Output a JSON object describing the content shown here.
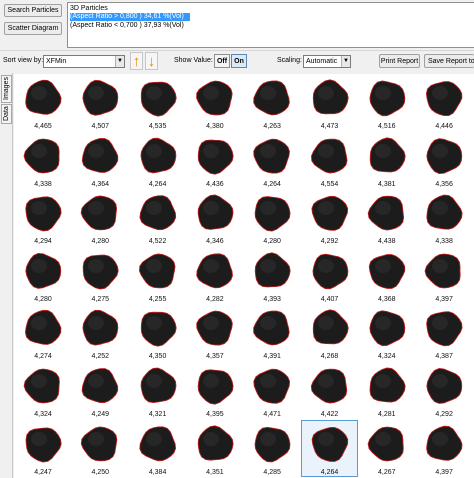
{
  "buttons": {
    "search_particles": "Search Particles",
    "scatter_diagram": "Scatter Diagram",
    "print_report": "Print Report",
    "save_report": "Save Report to R"
  },
  "filters": {
    "header": "3D Particles",
    "items": [
      {
        "label": "(Aspect Ratio > 0,800  ) 34,61 %(Vol)",
        "selected": true
      },
      {
        "label": "(Aspect Ratio < 0,700  ) 37,93 %(Vol)",
        "selected": false
      }
    ]
  },
  "toolbar": {
    "sort_label": "Sort view by:",
    "sort_value": "XFMin",
    "sort_asc_icon": "sort-ascending-arrow",
    "sort_desc_icon": "sort-descending-arrow",
    "show_value_label": "Show Value:",
    "off_label": "Off",
    "on_label": "On",
    "show_value_state": "On",
    "scaling_label": "Scaling:",
    "scaling_value": "Automatic"
  },
  "side_tabs": [
    "Images",
    "Data"
  ],
  "particles": [
    [
      "4,465",
      "4,507",
      "4,535",
      "4,380",
      "4,263",
      "4,473",
      "4,516",
      "4,446"
    ],
    [
      "4,338",
      "4,364",
      "4,264",
      "4,436",
      "4,264",
      "4,554",
      "4,381",
      "4,356"
    ],
    [
      "4,294",
      "4,280",
      "4,522",
      "4,346",
      "4,280",
      "4,292",
      "4,438",
      "4,338"
    ],
    [
      "4,280",
      "4,275",
      "4,255",
      "4,282",
      "4,393",
      "4,407",
      "4,368",
      "4,397"
    ],
    [
      "4,274",
      "4,252",
      "4,350",
      "4,357",
      "4,391",
      "4,268",
      "4,324",
      "4,387"
    ],
    [
      "4,324",
      "4,249",
      "4,321",
      "4,395",
      "4,471",
      "4,422",
      "4,281",
      "4,292"
    ],
    [
      "4,247",
      "4,250",
      "4,384",
      "4,351",
      "4,285",
      "4,264",
      "4,267",
      "4,397"
    ]
  ],
  "selected_particle": {
    "row": 6,
    "col": 5
  },
  "colors": {
    "particle_fill": "#1c1c1c",
    "particle_outline": "#c8201e",
    "selection": "#3399ff"
  }
}
